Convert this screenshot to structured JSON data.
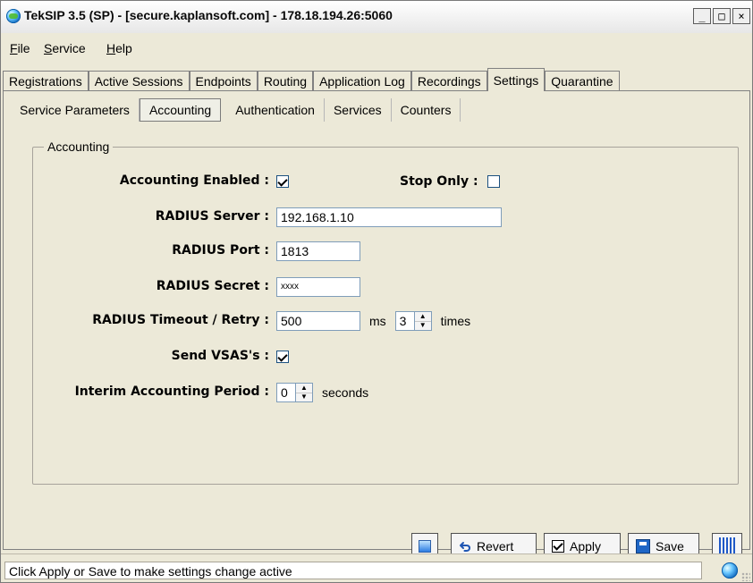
{
  "window": {
    "title": "TekSIP 3.5 (SP) - [secure.kaplansoft.com] - 178.18.194.26:5060",
    "min_symbol": "_",
    "max_symbol": "□",
    "close_symbol": "×"
  },
  "menu": {
    "items": [
      {
        "label": "File"
      },
      {
        "label": "Service"
      },
      {
        "label": "Help"
      }
    ]
  },
  "main_tabs": {
    "tabs": [
      {
        "label": "Registrations",
        "active": false
      },
      {
        "label": "Active Sessions",
        "active": false
      },
      {
        "label": "Endpoints",
        "active": false
      },
      {
        "label": "Routing",
        "active": false
      },
      {
        "label": "Application Log",
        "active": false
      },
      {
        "label": "Recordings",
        "active": false
      },
      {
        "label": "Settings",
        "active": true
      },
      {
        "label": "Quarantine",
        "active": false
      }
    ]
  },
  "sub_tabs": {
    "tabs": [
      {
        "label": "Service Parameters",
        "active": false
      },
      {
        "label": "Accounting",
        "active": true
      },
      {
        "label": "Authentication",
        "active": false
      },
      {
        "label": "Services",
        "active": false
      },
      {
        "label": "Counters",
        "active": false
      }
    ]
  },
  "accounting": {
    "group_title": "Accounting",
    "fields": {
      "accounting_enabled": {
        "label": "Accounting Enabled :",
        "checked": true
      },
      "stop_only": {
        "label": "Stop Only :",
        "checked": false
      },
      "radius_server": {
        "label": "RADIUS Server :",
        "value": "192.168.1.10"
      },
      "radius_port": {
        "label": "RADIUS Port :",
        "value": "1813"
      },
      "radius_secret": {
        "label": "RADIUS Secret :",
        "value": "xxxx"
      },
      "radius_timeout_retry": {
        "label": "RADIUS Timeout / Retry :",
        "timeout_value": "500",
        "timeout_unit": "ms",
        "retry_value": "3",
        "retry_unit": "times"
      },
      "send_vsas": {
        "label": "Send VSAS's :",
        "checked": true
      },
      "interim_period": {
        "label": "Interim Accounting Period :",
        "value": "0",
        "unit": "seconds"
      }
    }
  },
  "buttons": {
    "revert": "Revert",
    "apply": "Apply",
    "save": "Save"
  },
  "status": {
    "text": "Click Apply or Save to make settings change active"
  }
}
